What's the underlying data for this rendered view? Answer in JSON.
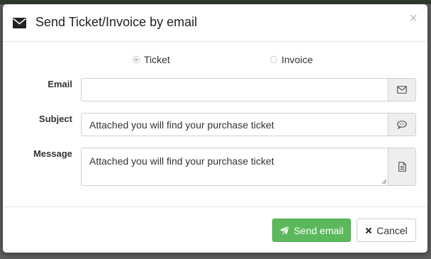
{
  "modal": {
    "title": "Send Ticket/Invoice by email",
    "close_symbol": "×",
    "header_icon": "envelope-icon"
  },
  "document_type": {
    "options": [
      {
        "label": "Ticket",
        "checked": true
      },
      {
        "label": "Invoice",
        "checked": false
      }
    ]
  },
  "form": {
    "email": {
      "label": "Email",
      "value": "",
      "placeholder": "",
      "addon_icon": "envelope-outline-icon"
    },
    "subject": {
      "label": "Subject",
      "value": "Attached you will find your purchase ticket",
      "addon_icon": "comment-icon"
    },
    "message": {
      "label": "Message",
      "value": "Attached you will find your purchase ticket",
      "addon_icon": "document-icon"
    }
  },
  "footer": {
    "send_label": "Send email",
    "send_icon": "paper-plane-icon",
    "cancel_label": "Cancel",
    "cancel_icon": "close-icon",
    "send_color": "#5cb85c"
  }
}
